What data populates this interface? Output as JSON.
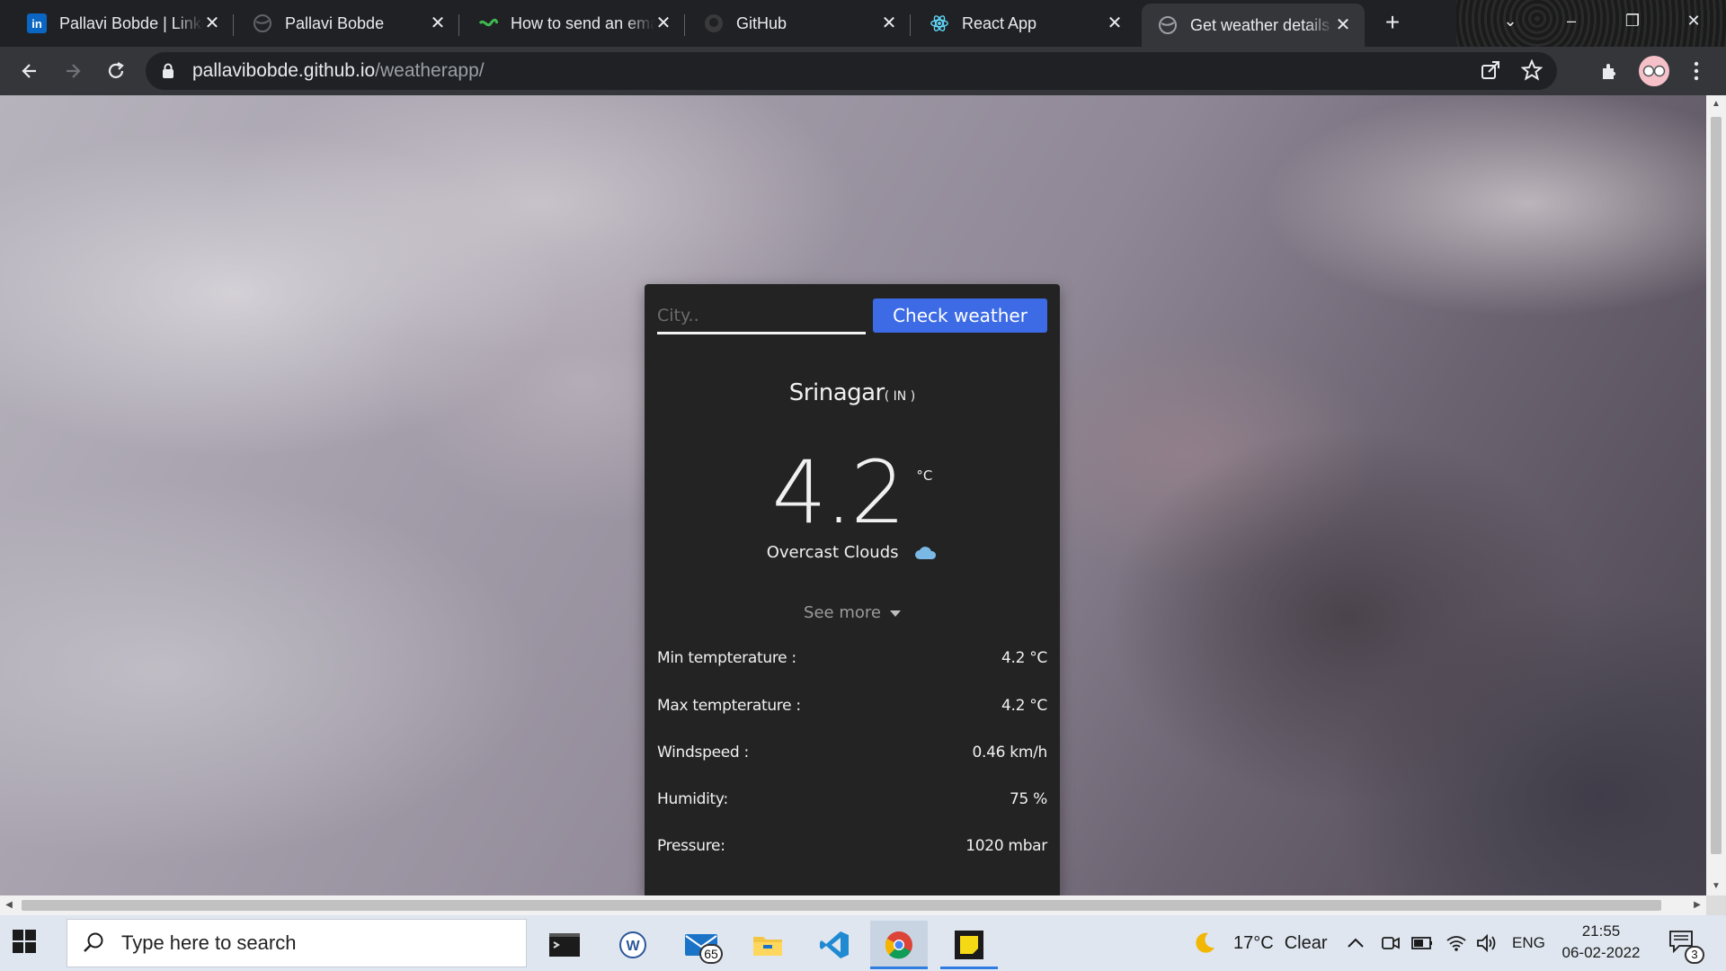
{
  "browser": {
    "tabs": [
      {
        "title": "Pallavi Bobde | LinkedIn",
        "favicon": "linkedin-icon"
      },
      {
        "title": "Pallavi Bobde",
        "favicon": "globe-icon"
      },
      {
        "title": "How to send an email",
        "favicon": "green-logo-icon"
      },
      {
        "title": "GitHub",
        "favicon": "github-icon"
      },
      {
        "title": "React App",
        "favicon": "react-icon"
      },
      {
        "title": "Get weather details",
        "favicon": "globe-icon"
      }
    ],
    "active_tab_index": 5,
    "url_host": "pallavibobde.github.io",
    "url_path": "/weatherapp/"
  },
  "weather_app": {
    "city_placeholder": "City..",
    "check_button_label": "Check weather",
    "city": "Srinagar",
    "country": "( IN )",
    "temperature": "4.2",
    "temperature_unit": "°C",
    "description": "Overcast Clouds",
    "see_more_label": "See more",
    "details": [
      {
        "label": "Min tempterature :",
        "value": "4.2 °C"
      },
      {
        "label": "Max tempterature :",
        "value": "4.2 °C"
      },
      {
        "label": "Windspeed :",
        "value": "0.46 km/h"
      },
      {
        "label": "Humidity:",
        "value": "75 %"
      },
      {
        "label": "Pressure:",
        "value": "1020 mbar"
      }
    ]
  },
  "taskbar": {
    "search_placeholder": "Type here to search",
    "mail_badge": "65",
    "weather_temp": "17°C",
    "weather_text": "Clear",
    "language": "ENG",
    "time": "21:55",
    "date": "06-02-2022",
    "notification_count": "3"
  },
  "colors": {
    "accent_button": "#3d6be6",
    "card_bg": "#232323",
    "browser_frame": "#202124"
  }
}
